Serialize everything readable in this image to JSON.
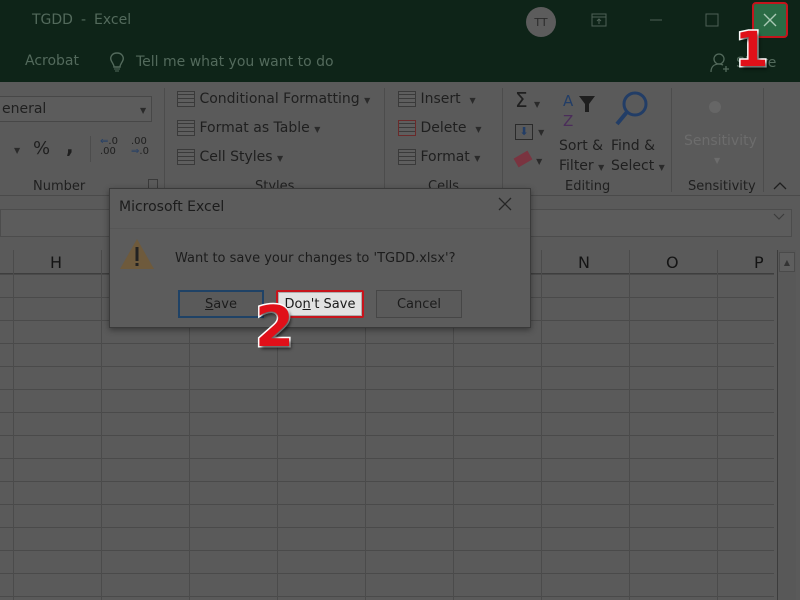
{
  "window": {
    "title_doc": "TGDD",
    "title_app": "Excel",
    "title_separator": "-",
    "avatar_initials": "TT",
    "controls": {
      "ribbon_display": "ribbon-display-icon",
      "minimize": "minimize-icon",
      "maximize": "maximize-icon",
      "close": "close-icon"
    }
  },
  "tab_row": {
    "acrobat_tab": "Acrobat",
    "tell_me_placeholder": "Tell me what you want to do",
    "share_label": "Share"
  },
  "ribbon": {
    "number": {
      "format_value": "General",
      "format_value_visible": "eneral",
      "percent": "%",
      "comma": ",",
      "increase_decimal": "←.0\n.00",
      "decrease_decimal": ".00\n→.0",
      "label": "Number"
    },
    "styles": {
      "conditional_formatting": "Conditional Formatting",
      "format_as_table": "Format as Table",
      "cell_styles": "Cell Styles",
      "label": "Styles"
    },
    "cells": {
      "insert": "Insert",
      "delete": "Delete",
      "format": "Format",
      "label": "Cells"
    },
    "editing": {
      "autosum": "Σ",
      "sort_filter_line1": "Sort &",
      "sort_filter_line2": "Filter",
      "find_select_line1": "Find &",
      "find_select_line2": "Select",
      "label": "Editing"
    },
    "sensitivity": {
      "button": "Sensitivity",
      "label": "Sensitivity"
    }
  },
  "sheet": {
    "column_headers": [
      "H",
      "N",
      "O",
      "P"
    ]
  },
  "dialog": {
    "title": "Microsoft Excel",
    "message": "Want to save your changes to 'TGDD.xlsx'?",
    "buttons": {
      "save": {
        "pre": "",
        "accel": "S",
        "post": "ave"
      },
      "dont_save": {
        "pre": "Do",
        "accel": "n",
        "post": "'t Save"
      },
      "cancel": "Cancel"
    }
  },
  "annotations": {
    "step1": "1",
    "step2": "2",
    "highlight_color": "#c7141c"
  }
}
